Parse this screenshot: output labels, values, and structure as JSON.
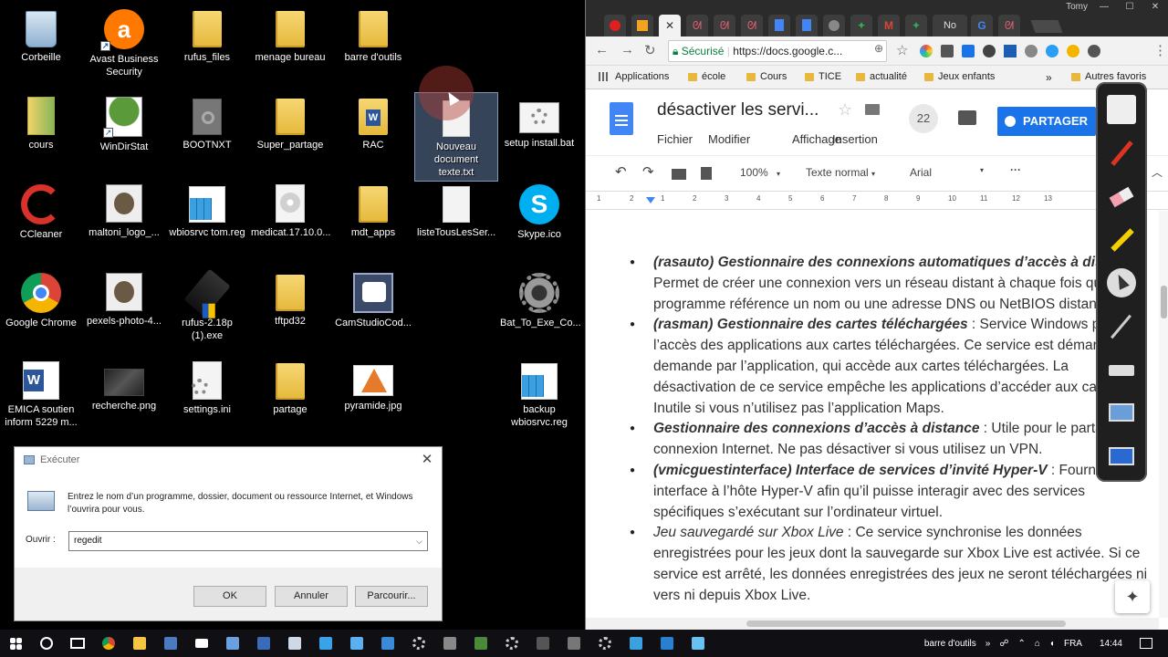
{
  "desktop": {
    "icons": [
      {
        "label": "Corbeille"
      },
      {
        "label": "Avast Business\nSecurity"
      },
      {
        "label": "rufus_files"
      },
      {
        "label": "menage bureau"
      },
      {
        "label": "barre d'outils"
      },
      {
        "label": "cours"
      },
      {
        "label": "WinDirStat"
      },
      {
        "label": "BOOTNXT"
      },
      {
        "label": "Super_partage"
      },
      {
        "label": "RAC"
      },
      {
        "label": "Nouveau\ndocument\ntexte.txt"
      },
      {
        "label": "setup install.bat"
      },
      {
        "label": "CCleaner"
      },
      {
        "label": "maltoni_logo_..."
      },
      {
        "label": "wbiosrvc tom.reg"
      },
      {
        "label": "medicat.17.10.0..."
      },
      {
        "label": "mdt_apps"
      },
      {
        "label": "listeTousLesSer..."
      },
      {
        "label": "Skype.ico"
      },
      {
        "label": "Google Chrome"
      },
      {
        "label": "pexels-photo-4..."
      },
      {
        "label": "rufus-2.18p\n(1).exe"
      },
      {
        "label": "tftpd32"
      },
      {
        "label": "CamStudioCod..."
      },
      {
        "label": "Bat_To_Exe_Co..."
      },
      {
        "label": "EMICA soutien\ninform 5229 m..."
      },
      {
        "label": "recherche.png"
      },
      {
        "label": "settings.ini"
      },
      {
        "label": "partage"
      },
      {
        "label": "pyramide.jpg"
      },
      {
        "label": "backup\nwbiosrvc.reg"
      }
    ]
  },
  "run_dialog": {
    "title": "Exécuter",
    "description": "Entrez le nom d’un programme, dossier, document ou ressource Internet, et Windows l’ouvrira pour vous.",
    "open_label": "Ouvrir :",
    "open_value": "regedit",
    "ok": "OK",
    "cancel": "Annuler",
    "browse": "Parcourir..."
  },
  "chrome": {
    "profile": "Tomy",
    "tab_label": "No",
    "secure": "Sécurisé",
    "url": "https://docs.google.c...",
    "bookmarks": [
      "Applications",
      "école",
      "Cours",
      "TICE",
      "actualité",
      "Jeux enfants",
      "Autres favoris"
    ]
  },
  "docs": {
    "title": "désactiver les servi...",
    "menus": [
      "Fichier",
      "Modifier",
      "Affichage",
      "Insertion"
    ],
    "comment_count": "22",
    "share": "PARTAGER",
    "zoom": "100%",
    "style": "Texte normal",
    "font": "Arial",
    "more": "···",
    "ruler": [
      "1",
      "2",
      "1",
      "2",
      "3",
      "4",
      "5",
      "6",
      "7",
      "8",
      "9",
      "10",
      "11",
      "12",
      "13"
    ],
    "items": [
      {
        "bold": "(rasauto) Gestionnaire des connexions automatiques d’accès à distance",
        "text": " : Permet de créer une connexion vers un réseau distant à chaque fois qu’un programme référence un nom ou une adresse DNS ou NetBIOS distant."
      },
      {
        "bold": "(rasman) Gestionnaire des cartes téléchargées",
        "text": " : Service Windows pour l’accès des applications aux cartes téléchargées. Ce service est démarré à la demande par l’application, qui accède aux cartes téléchargées. La désactivation de ce service empêche les applications d’accéder aux cartes. Inutile si vous n’utilisez pas l’application Maps."
      },
      {
        "bold": "Gestionnaire des connexions d’accès à distance",
        "text": " : Utile pour le partage de connexion Internet. Ne pas désactiver si vous utilisez un VPN."
      },
      {
        "bold": "(vmicguestinterface) Interface de services d’invité Hyper-V",
        "text": " : Fournit une interface à l’hôte Hyper-V afin qu’il puisse interagir avec des services spécifiques s’exécutant sur l’ordinateur virtuel."
      },
      {
        "italic": "Jeu sauvegardé sur Xbox Live",
        "text": " : Ce service synchronise les données enregistrées pour les jeux dont la sauvegarde sur Xbox Live est activée. Si ce service est arrêté, les données enregistrées des jeux ne seront téléchargées ni vers ni depuis Xbox Live."
      }
    ]
  },
  "taskbar": {
    "toolbar_label": "barre d'outils",
    "lang": "FRA",
    "time": "14:44"
  },
  "colors": {
    "desktop": "#000000",
    "share_button": "#1a73e8",
    "docs_icon": "#4285f4",
    "secure_green": "#0b8043"
  }
}
